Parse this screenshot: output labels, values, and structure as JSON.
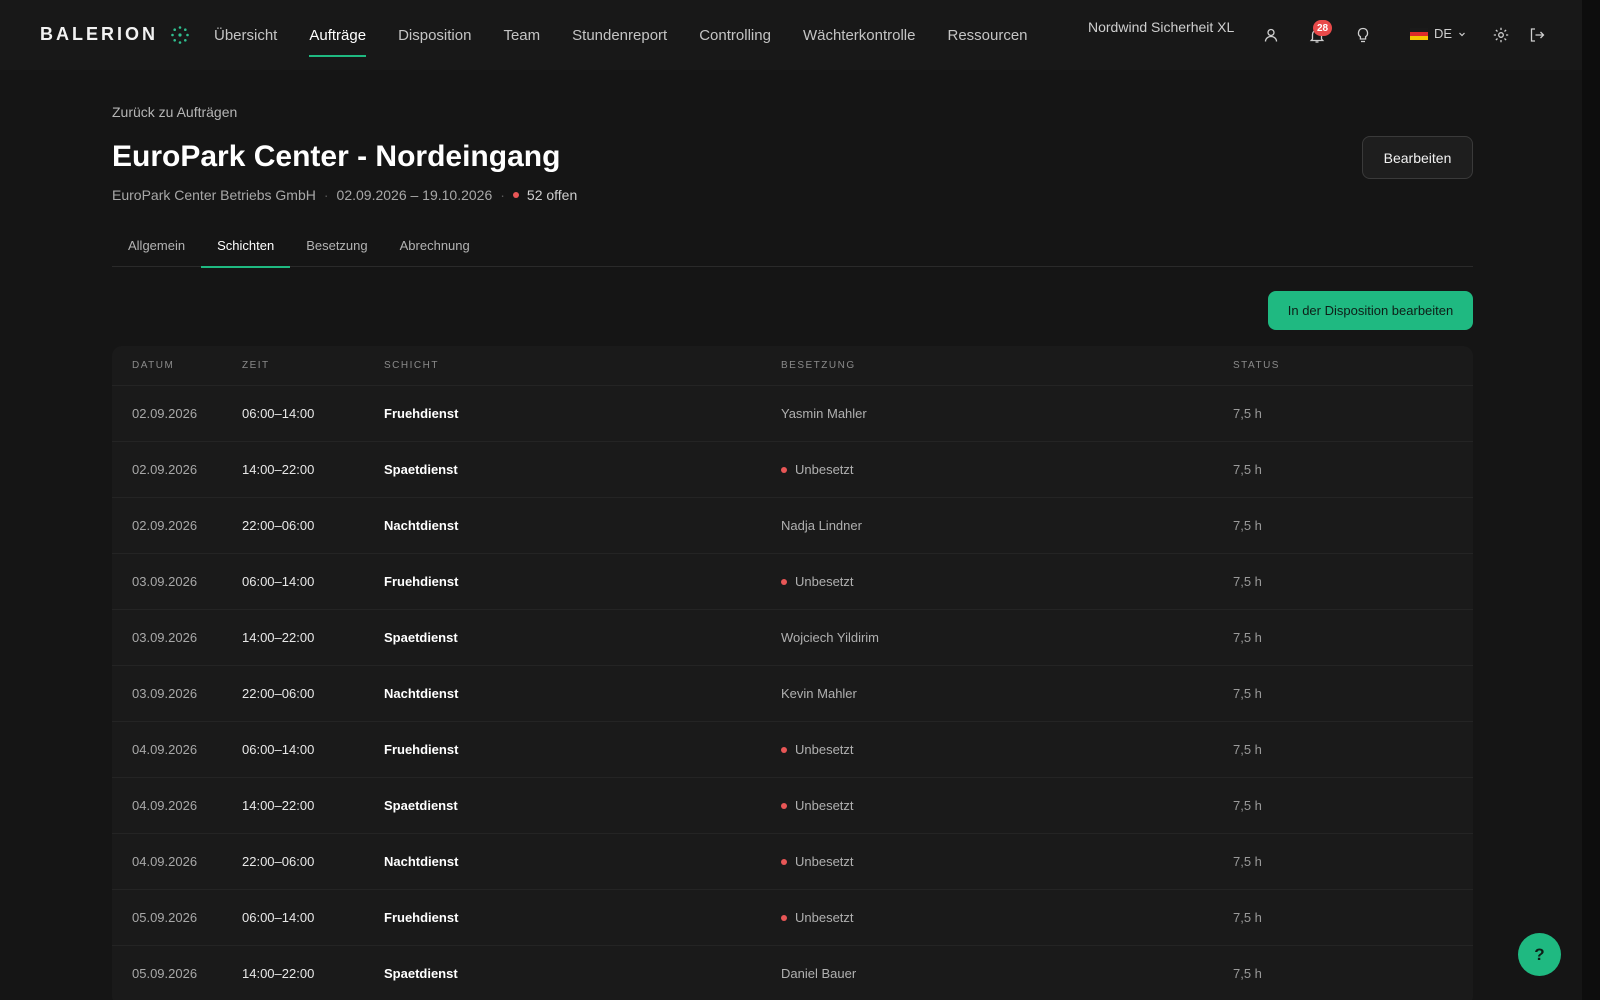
{
  "app": {
    "logo": "BALERION",
    "company": "Nordwind Sicherheit XL",
    "notifications": "28",
    "language": "DE"
  },
  "nav": {
    "items": [
      {
        "label": "Übersicht",
        "active": false
      },
      {
        "label": "Aufträge",
        "active": true
      },
      {
        "label": "Disposition",
        "active": false
      },
      {
        "label": "Team",
        "active": false
      },
      {
        "label": "Stundenreport",
        "active": false
      },
      {
        "label": "Controlling",
        "active": false
      },
      {
        "label": "Wächterkontrolle",
        "active": false
      },
      {
        "label": "Ressourcen",
        "active": false
      }
    ]
  },
  "header": {
    "back_label": "Zurück zu Aufträgen",
    "title": "EuroPark Center - Nordeingang",
    "client": "EuroPark Center Betriebs GmbH",
    "period": "02.09.2026 – 19.10.2026",
    "open": "52 offen",
    "edit_label": "Bearbeiten"
  },
  "tabs": [
    {
      "label": "Allgemein",
      "active": false
    },
    {
      "label": "Schichten",
      "active": true
    },
    {
      "label": "Besetzung",
      "active": false
    },
    {
      "label": "Abrechnung",
      "active": false
    }
  ],
  "dispo_button": "In der Disposition bearbeiten",
  "table": {
    "headers": {
      "date": "DATUM",
      "time": "ZEIT",
      "shift": "SCHICHT",
      "staff": "BESETZUNG",
      "status": "STATUS"
    },
    "rows": [
      {
        "date": "02.09.2026",
        "time": "06:00–14:00",
        "shift": "Fruehdienst",
        "staff": "Yasmin Mahler",
        "unstaffed": false,
        "status": "7,5 h"
      },
      {
        "date": "02.09.2026",
        "time": "14:00–22:00",
        "shift": "Spaetdienst",
        "staff": "Unbesetzt",
        "unstaffed": true,
        "status": "7,5 h"
      },
      {
        "date": "02.09.2026",
        "time": "22:00–06:00",
        "shift": "Nachtdienst",
        "staff": "Nadja Lindner",
        "unstaffed": false,
        "status": "7,5 h"
      },
      {
        "date": "03.09.2026",
        "time": "06:00–14:00",
        "shift": "Fruehdienst",
        "staff": "Unbesetzt",
        "unstaffed": true,
        "status": "7,5 h"
      },
      {
        "date": "03.09.2026",
        "time": "14:00–22:00",
        "shift": "Spaetdienst",
        "staff": "Wojciech Yildirim",
        "unstaffed": false,
        "status": "7,5 h"
      },
      {
        "date": "03.09.2026",
        "time": "22:00–06:00",
        "shift": "Nachtdienst",
        "staff": "Kevin Mahler",
        "unstaffed": false,
        "status": "7,5 h"
      },
      {
        "date": "04.09.2026",
        "time": "06:00–14:00",
        "shift": "Fruehdienst",
        "staff": "Unbesetzt",
        "unstaffed": true,
        "status": "7,5 h"
      },
      {
        "date": "04.09.2026",
        "time": "14:00–22:00",
        "shift": "Spaetdienst",
        "staff": "Unbesetzt",
        "unstaffed": true,
        "status": "7,5 h"
      },
      {
        "date": "04.09.2026",
        "time": "22:00–06:00",
        "shift": "Nachtdienst",
        "staff": "Unbesetzt",
        "unstaffed": true,
        "status": "7,5 h"
      },
      {
        "date": "05.09.2026",
        "time": "06:00–14:00",
        "shift": "Fruehdienst",
        "staff": "Unbesetzt",
        "unstaffed": true,
        "status": "7,5 h"
      },
      {
        "date": "05.09.2026",
        "time": "14:00–22:00",
        "shift": "Spaetdienst",
        "staff": "Daniel Bauer",
        "unstaffed": false,
        "status": "7,5 h"
      }
    ]
  },
  "help_label": "?",
  "colors": {
    "accent": "#1fb981",
    "alert": "#e85656",
    "background": "#151515"
  },
  "icons": [
    "logo-mark-icon",
    "user-icon",
    "bell-icon",
    "lightbulb-icon",
    "flag-de-icon",
    "chevron-down-icon",
    "gear-icon",
    "logout-icon"
  ]
}
